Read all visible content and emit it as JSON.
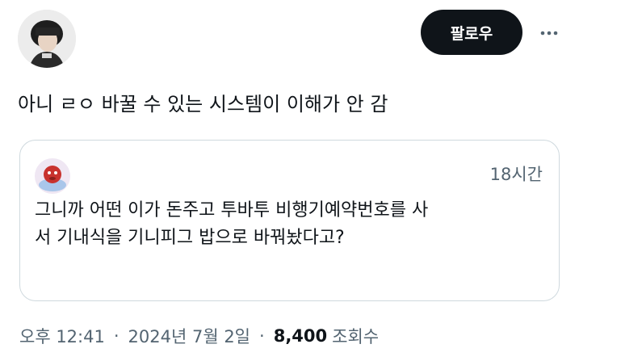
{
  "header": {
    "follow_label": "팔로우",
    "more_icon": "more-horizontal-icon"
  },
  "tweet": {
    "text": "아니 ㄹㅇ 바꿀 수 있는 시스템이 이해가 안 감",
    "time": "오후 12:41",
    "date": "2024년 7월 2일",
    "separator": "·",
    "views_count": "8,400",
    "views_label": "조회수"
  },
  "quoted": {
    "time": "18시간",
    "lines": [
      "그니까 어떤 이가 돈주고 투바투 비행기예약번호를 사",
      "서 기내식을 기니피그 밥으로 바꿔놨다고?"
    ]
  },
  "colors": {
    "text_primary": "#0f1419",
    "text_secondary": "#536471",
    "follow_bg": "#0f1419",
    "card_border": "#cfd9de"
  }
}
